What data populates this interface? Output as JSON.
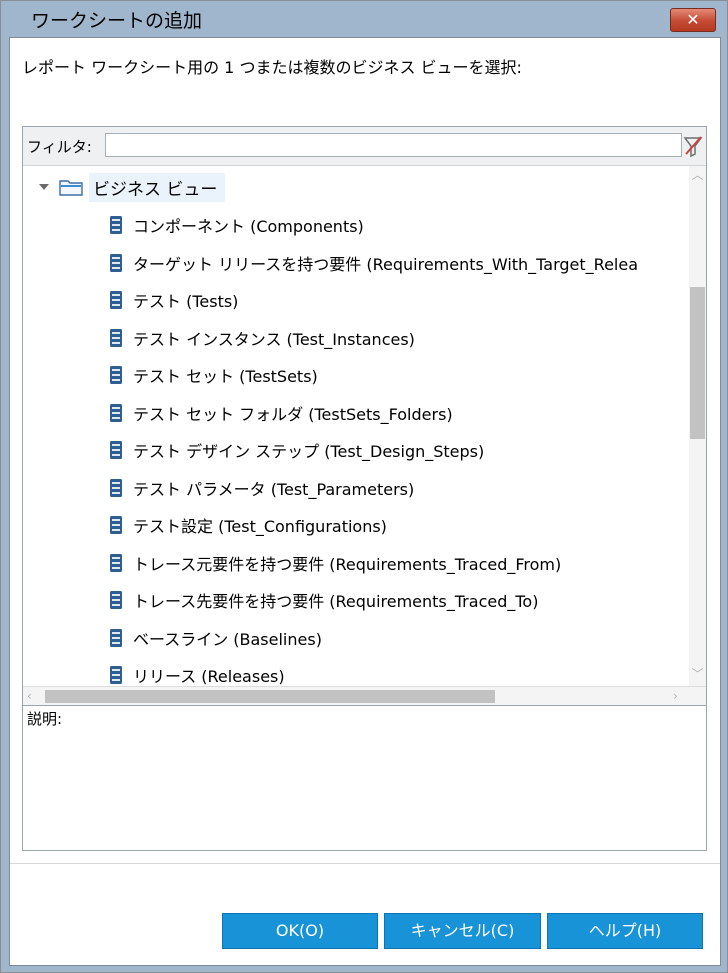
{
  "window": {
    "title": "ワークシートの追加",
    "close_label": "✕"
  },
  "instruction": "レポート ワークシート用の 1 つまたは複数のビジネス ビューを選択:",
  "filter": {
    "label": "フィルタ:",
    "value": "",
    "placeholder": ""
  },
  "tree": {
    "root_label": "ビジネス ビュー",
    "items": [
      "コンポーネント (Components)",
      "ターゲット リリースを持つ要件 (Requirements_With_Target_Relea",
      "テスト (Tests)",
      "テスト インスタンス (Test_Instances)",
      "テスト セット (TestSets)",
      "テスト セット フォルダ (TestSets_Folders)",
      "テスト デザイン ステップ (Test_Design_Steps)",
      "テスト パラメータ (Test_Parameters)",
      "テスト設定 (Test_Configurations)",
      "トレース元要件を持つ要件 (Requirements_Traced_From)",
      "トレース先要件を持つ要件 (Requirements_Traced_To)",
      "ベースライン (Baselines)",
      "リリース (Releases)"
    ]
  },
  "description": {
    "label": "説明:"
  },
  "buttons": {
    "ok": "OK(O)",
    "cancel": "キャンセル(C)",
    "help": "ヘルプ(H)"
  },
  "colors": {
    "titlebar": "#9fb6cc",
    "button": "#1993d8",
    "close_button": "#c44a33"
  }
}
